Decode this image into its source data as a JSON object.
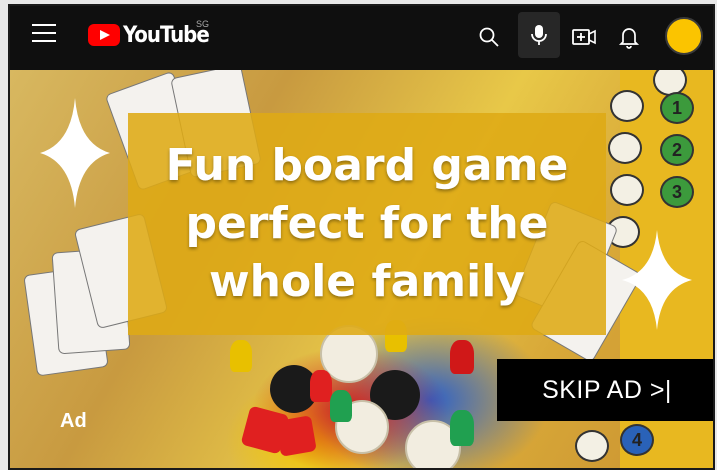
{
  "app": {
    "logo_text": "YouTube",
    "region": "SG"
  },
  "header": {
    "icons": [
      "menu-icon",
      "search-icon",
      "mic-icon",
      "create-icon",
      "notifications-icon",
      "avatar"
    ]
  },
  "ad": {
    "headline_lines": [
      "Fun board game",
      "perfect for the",
      "whole family"
    ],
    "ad_label": "Ad",
    "skip_label": "SKIP AD >|"
  },
  "board": {
    "slot_numbers": [
      "1",
      "2",
      "3",
      "4"
    ]
  },
  "colors": {
    "brand_red": "#ff0000",
    "avatar": "#fbc400",
    "overlay": "#deaa14"
  }
}
